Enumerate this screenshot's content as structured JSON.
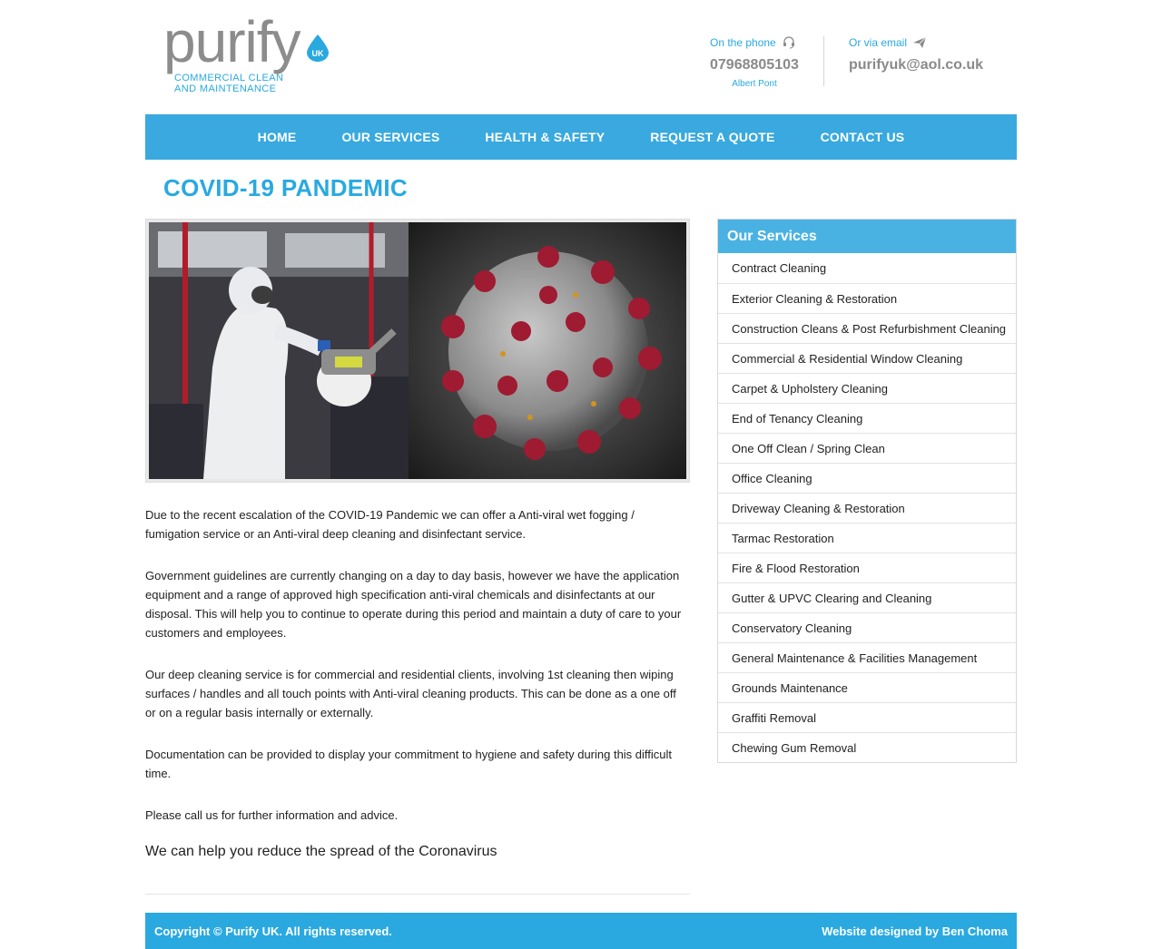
{
  "header": {
    "logo_word": "purify",
    "logo_badge": "UK",
    "logo_tagline_1": "COMMERCIAL CLEAN",
    "logo_tagline_2": "AND  MAINTENANCE",
    "phone_label": "On the phone",
    "phone_value": "07968805103",
    "phone_sub": "Albert Pont",
    "email_label": "Or via email",
    "email_value": "purifyuk@aol.co.uk",
    "phone_icon": "headset-icon",
    "email_icon": "paper-plane-icon"
  },
  "nav": {
    "items": [
      "HOME",
      "OUR SERVICES",
      "HEALTH & SAFETY",
      "REQUEST A QUOTE",
      "CONTACT US"
    ]
  },
  "page": {
    "title": "COVID-19 PANDEMIC",
    "paragraphs": [
      "Due to the recent escalation of the COVID-19 Pandemic we can offer a Anti-viral wet fogging / fumigation service or an Anti-viral deep cleaning and disinfectant service.",
      "Government guidelines are currently changing on a day to day basis, however we have the application equipment and a range of approved high specification anti-viral chemicals and disinfectants at our disposal. This will help you to continue to operate during this period and maintain a duty of care to your customers and employees.",
      "Our deep cleaning service is for commercial and residential clients, involving 1st cleaning then wiping surfaces / handles and all touch points with Anti-viral cleaning products. This can be done as a one off or on a regular basis internally or externally.",
      "Documentation can be provided to display your commitment to hygiene and safety during this difficult time.",
      "Please call us for further information and advice."
    ],
    "lead": "We can help you reduce the spread of the Coronavirus"
  },
  "sidebar": {
    "heading": "Our Services",
    "items": [
      "Contract Cleaning",
      "Exterior Cleaning & Restoration",
      "Construction Cleans & Post Refurbishment Cleaning",
      "Commercial & Residential Window Cleaning",
      "Carpet & Upholstery Cleaning",
      "End of Tenancy Cleaning",
      "One Off Clean / Spring Clean",
      "Office Cleaning",
      "Driveway Cleaning & Restoration",
      "Tarmac Restoration",
      "Fire & Flood Restoration",
      "Gutter & UPVC Clearing and Cleaning",
      "Conservatory Cleaning",
      "General Maintenance & Facilities Management",
      "Grounds Maintenance",
      "Graffiti Removal",
      "Chewing Gum Removal"
    ]
  },
  "footer": {
    "copyright": "Copyright © Purify UK. All rights reserved.",
    "credit": "Website designed by Ben Choma"
  },
  "colors": {
    "brand_blue": "#29a9e0",
    "nav_blue": "#39a9df",
    "logo_grey": "#8c8c8c",
    "virus_red": "#9e1b32"
  }
}
